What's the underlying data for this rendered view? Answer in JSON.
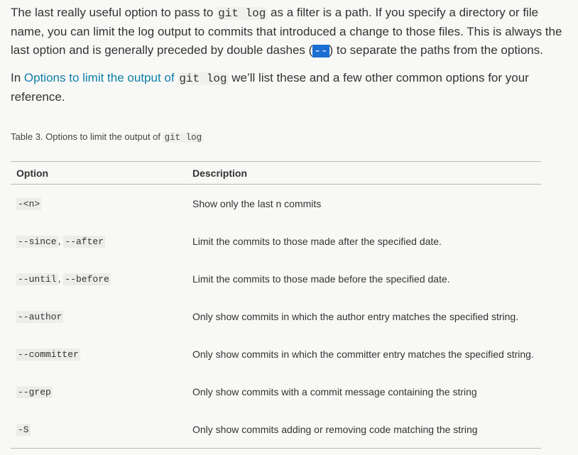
{
  "p1": {
    "t1": "The last really useful option to pass to ",
    "code": "git log",
    "t2": " as a filter is a path. If you specify a directory or file name, you can limit the log output to commits that introduced a change to those files. This is always the last option and is generally preceded by double dashes (",
    "dashes": "--",
    "t3": ") to separate the paths from the options."
  },
  "p2": {
    "t1": "In ",
    "link": "Options to limit the output of ",
    "link_code": "git log",
    "t2": " we’ll list these and a few other common options for your reference."
  },
  "caption": {
    "text": "Table 3. Options to limit the output of ",
    "code": "git log"
  },
  "table": {
    "headers": [
      "Option",
      "Description"
    ],
    "separator": ", ",
    "rows": [
      {
        "options": [
          "-<n>"
        ],
        "description": "Show only the last n commits"
      },
      {
        "options": [
          "--since",
          "--after"
        ],
        "description": "Limit the commits to those made after the specified date."
      },
      {
        "options": [
          "--until",
          "--before"
        ],
        "description": "Limit the commits to those made before the specified date."
      },
      {
        "options": [
          "--author"
        ],
        "description": "Only show commits in which the author entry matches the specified string."
      },
      {
        "options": [
          "--committer"
        ],
        "description": "Only show commits in which the committer entry matches the specified string."
      },
      {
        "options": [
          "--grep"
        ],
        "description": "Only show commits with a commit message containing the string"
      },
      {
        "options": [
          "-S"
        ],
        "description": "Only show commits adding or removing code matching the string"
      }
    ]
  }
}
